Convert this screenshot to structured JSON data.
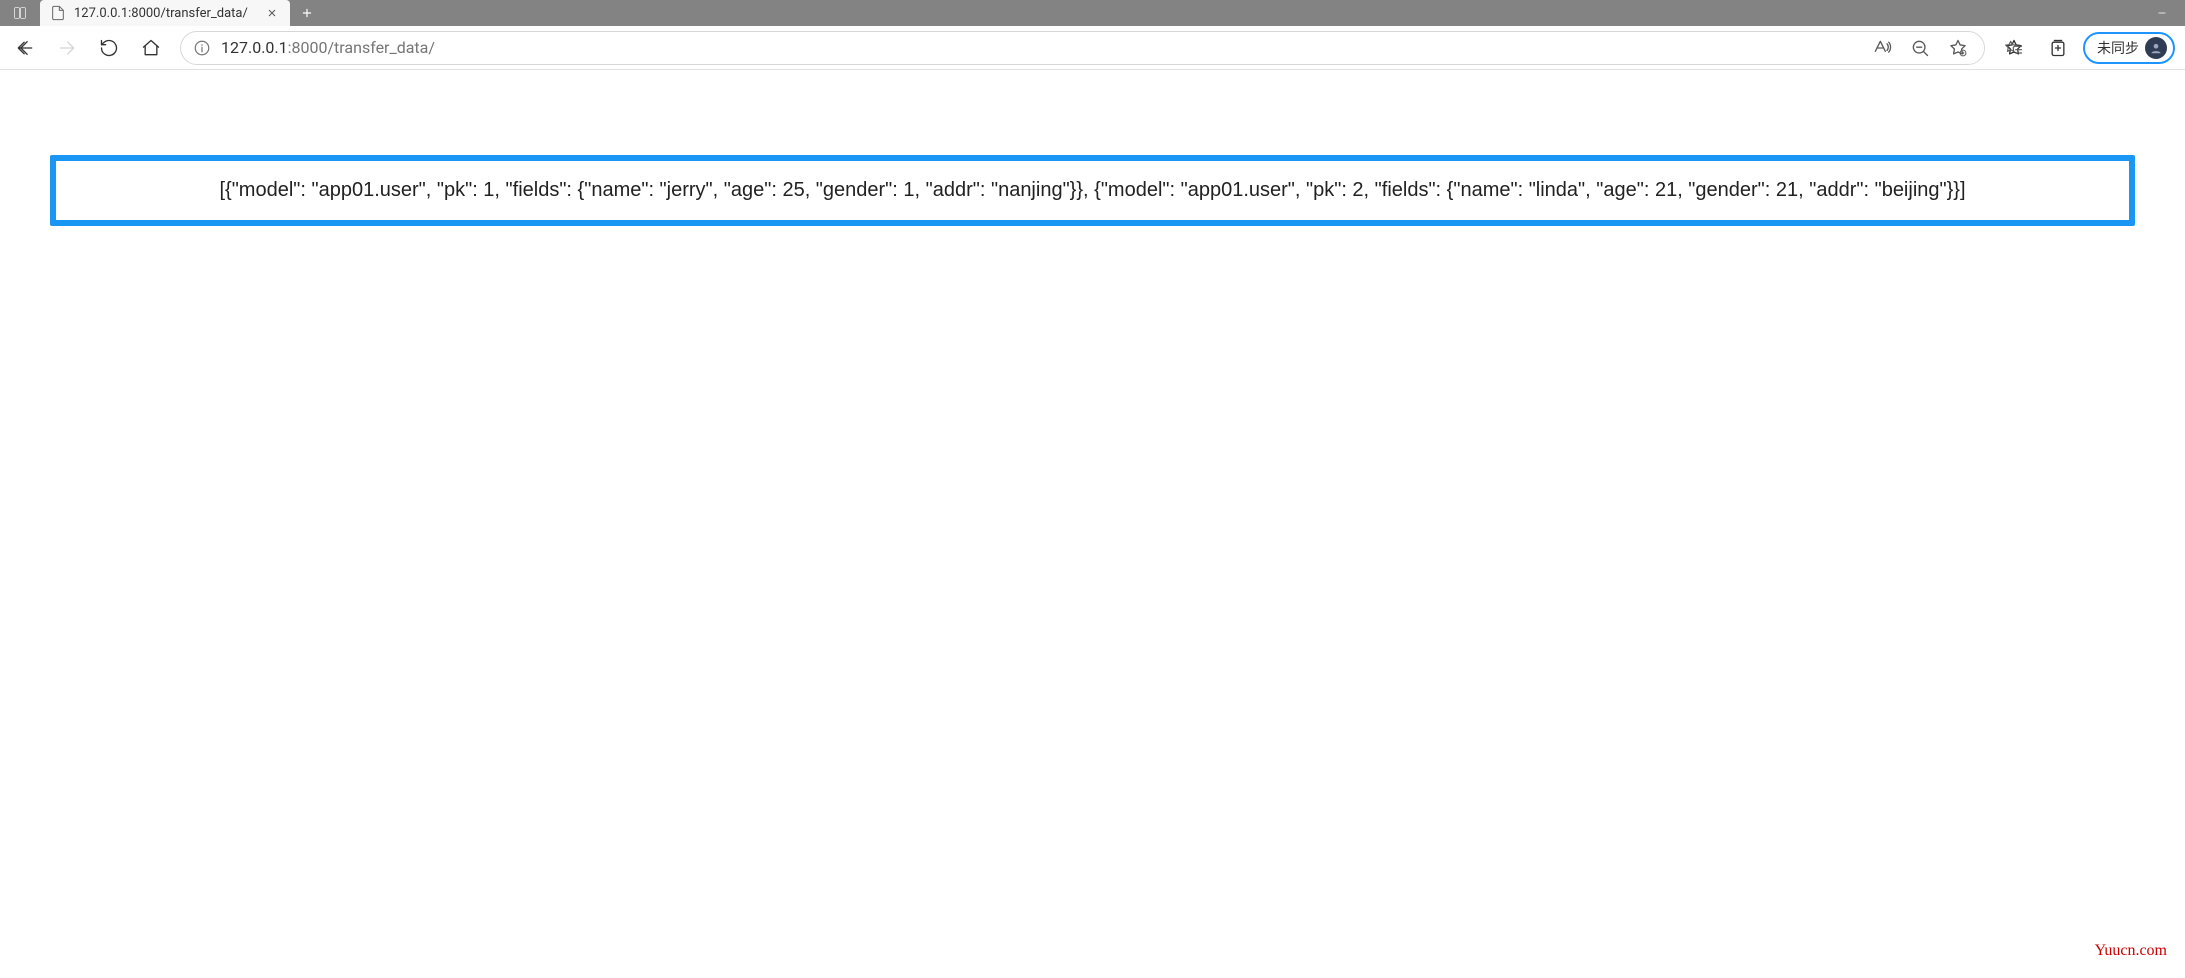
{
  "tab": {
    "title": "127.0.0.1:8000/transfer_data/"
  },
  "address_bar": {
    "host": "127.0.0.1",
    "port": ":8000",
    "path": "/transfer_data/"
  },
  "sync": {
    "label": "未同步"
  },
  "page": {
    "body_text": "[{\"model\": \"app01.user\", \"pk\": 1, \"fields\": {\"name\": \"jerry\", \"age\": 25, \"gender\": 1, \"addr\": \"nanjing\"}}, {\"model\": \"app01.user\", \"pk\": 2, \"fields\": {\"name\": \"linda\", \"age\": 21, \"gender\": 21, \"addr\": \"beijing\"}}]"
  },
  "watermark": "Yuucn.com"
}
